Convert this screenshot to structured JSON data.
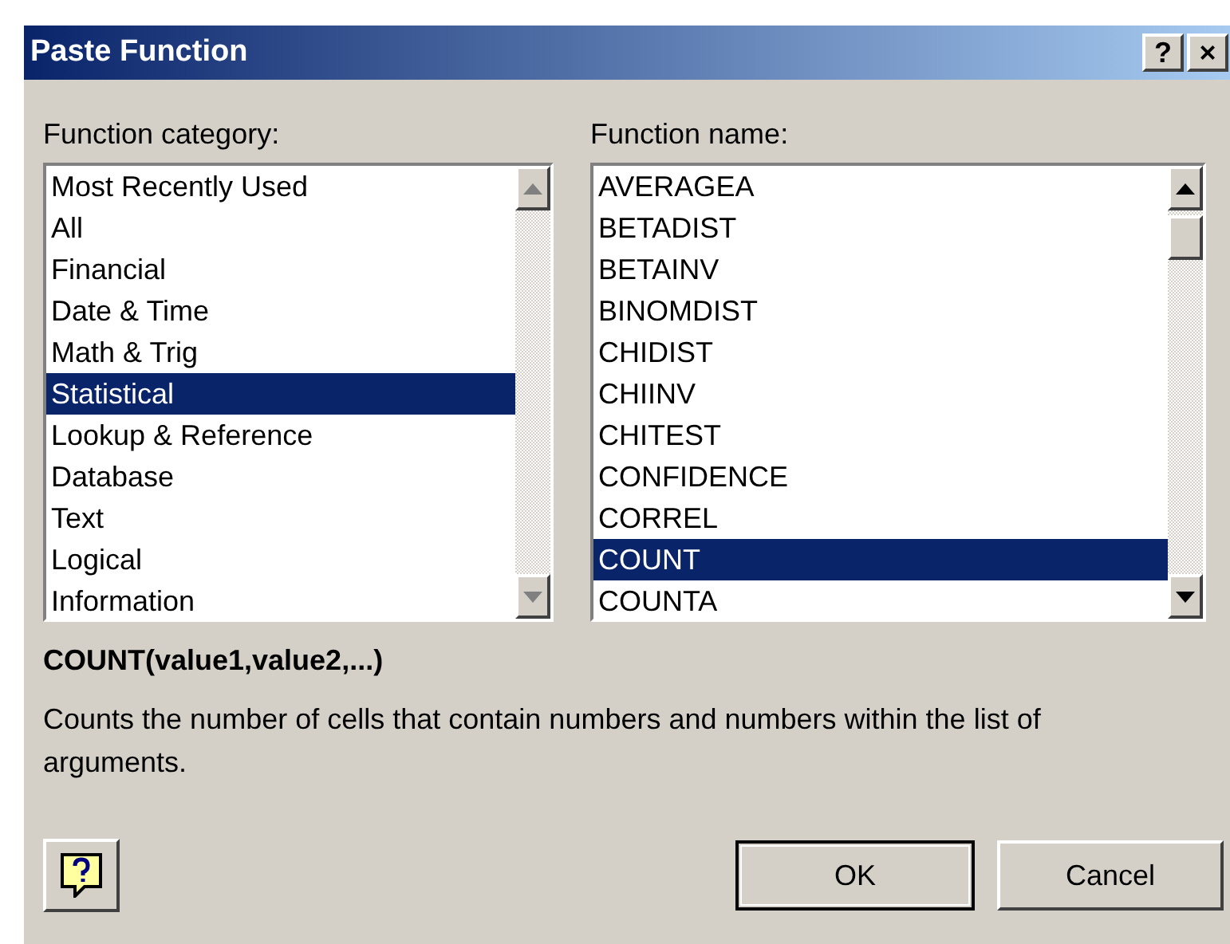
{
  "window": {
    "title": "Paste Function",
    "title_buttons": [
      "?",
      "×"
    ]
  },
  "category_list": {
    "label": "Function category:",
    "items": [
      {
        "text": "Most Recently Used",
        "selected": false
      },
      {
        "text": "All",
        "selected": false
      },
      {
        "text": "Financial",
        "selected": false
      },
      {
        "text": "Date & Time",
        "selected": false
      },
      {
        "text": "Math & Trig",
        "selected": false
      },
      {
        "text": "Statistical",
        "selected": true
      },
      {
        "text": "Lookup & Reference",
        "selected": false
      },
      {
        "text": "Database",
        "selected": false
      },
      {
        "text": "Text",
        "selected": false
      },
      {
        "text": "Logical",
        "selected": false
      },
      {
        "text": "Information",
        "selected": false
      }
    ]
  },
  "function_list": {
    "label": "Function name:",
    "items": [
      {
        "text": "AVERAGEA",
        "selected": false
      },
      {
        "text": "BETADIST",
        "selected": false
      },
      {
        "text": "BETAINV",
        "selected": false
      },
      {
        "text": "BINOMDIST",
        "selected": false
      },
      {
        "text": "CHIDIST",
        "selected": false
      },
      {
        "text": "CHIINV",
        "selected": false
      },
      {
        "text": "CHITEST",
        "selected": false
      },
      {
        "text": "CONFIDENCE",
        "selected": false
      },
      {
        "text": "CORREL",
        "selected": false
      },
      {
        "text": "COUNT",
        "selected": true
      },
      {
        "text": "COUNTA",
        "selected": false
      }
    ]
  },
  "syntax": "COUNT(value1,value2,...)",
  "description": "Counts the number of cells that contain numbers and numbers within the list of arguments.",
  "buttons": [
    "OK",
    "Cancel"
  ]
}
